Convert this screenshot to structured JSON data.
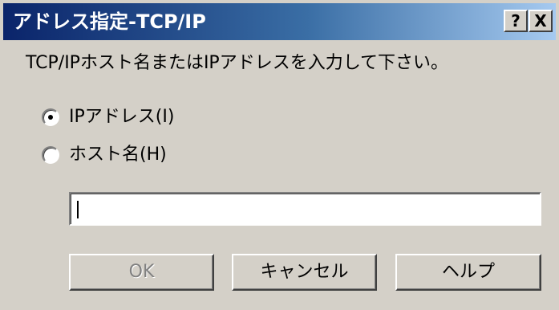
{
  "window": {
    "title": "アドレス指定-TCP/IP",
    "help_glyph": "?",
    "close_glyph": "X"
  },
  "prompt": "TCP/IPホスト名またはIPアドレスを入力して下さい。",
  "options": [
    {
      "label": "IPアドレス(I)",
      "selected": true
    },
    {
      "label": "ホスト名(H)",
      "selected": false
    }
  ],
  "address_input": {
    "value": ""
  },
  "buttons": {
    "ok": "OK",
    "cancel": "キャンセル",
    "help": "ヘルプ"
  }
}
